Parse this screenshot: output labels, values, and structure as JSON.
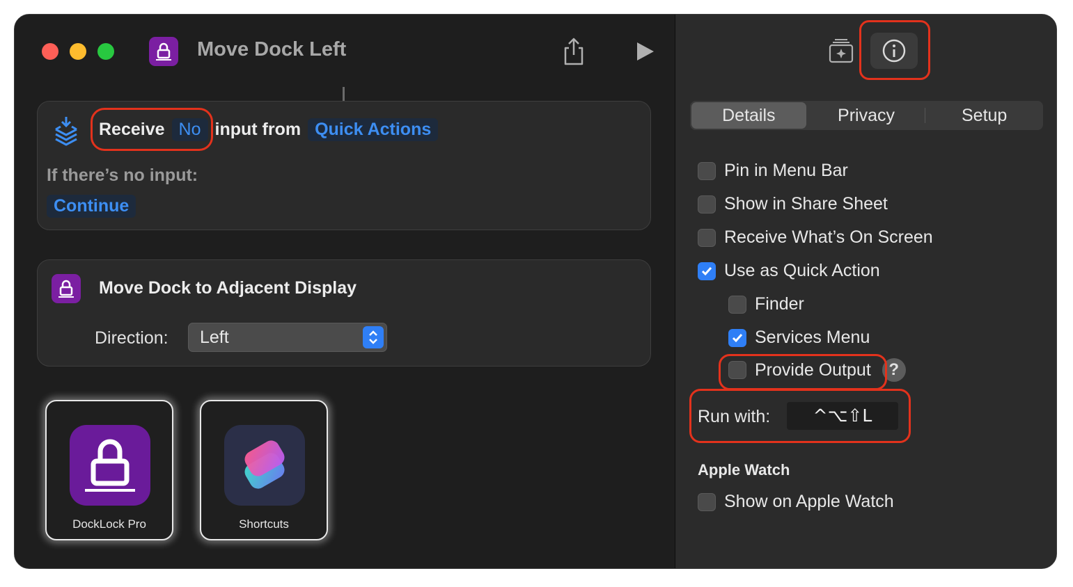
{
  "window": {
    "title": "Move Dock Left"
  },
  "editor": {
    "receive_block": {
      "receive_label": "Receive",
      "input_type": "No",
      "input_from_label": "input from",
      "source": "Quick Actions",
      "no_input_label": "If there’s no input:",
      "no_input_action": "Continue"
    },
    "action_block": {
      "title": "Move Dock to Adjacent Display",
      "direction_label": "Direction:",
      "direction_value": "Left"
    },
    "dock_apps": [
      {
        "label": "DockLock Pro",
        "icon": "lock-icon"
      },
      {
        "label": "Shortcuts",
        "icon": "shortcuts-icon"
      }
    ]
  },
  "inspector": {
    "tabs": [
      "Details",
      "Privacy",
      "Setup"
    ],
    "active_tab": "Details",
    "options": [
      {
        "label": "Pin in Menu Bar",
        "checked": false
      },
      {
        "label": "Show in Share Sheet",
        "checked": false
      },
      {
        "label": "Receive What’s On Screen",
        "checked": false
      },
      {
        "label": "Use as Quick Action",
        "checked": true
      },
      {
        "label": "Finder",
        "checked": false
      },
      {
        "label": "Services Menu",
        "checked": true
      },
      {
        "label": "Provide Output",
        "checked": false
      }
    ],
    "help_label": "?",
    "run_with_label": "Run with:",
    "shortcut": "^⌥⇧L",
    "apple_watch_heading": "Apple Watch",
    "apple_watch_option": {
      "label": "Show on Apple Watch",
      "checked": false
    }
  },
  "colors": {
    "accent": "#2f7ff6",
    "highlight_ring": "#e3321c",
    "token_text": "#3d8ef2",
    "app_purple": "#7b1fa2"
  }
}
